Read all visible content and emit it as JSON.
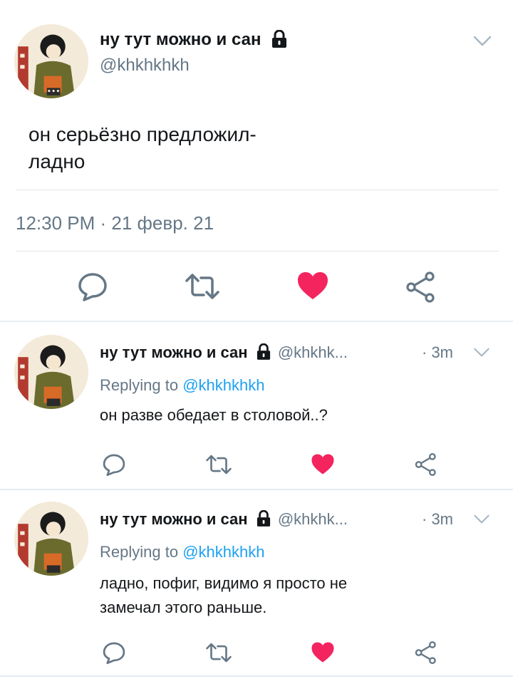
{
  "main_tweet": {
    "display_name": "ну тут можно и сан",
    "handle": "@khkhkhkh",
    "text_line1": "он серьёзно предложил-",
    "text_line2": "ладно",
    "timestamp": "12:30 PM · 21 февр. 21"
  },
  "replies": [
    {
      "display_name": "ну тут можно и сан",
      "handle": "@khkhk...",
      "time": "· 3m",
      "replying_prefix": "Replying to ",
      "replying_to": "@khkhkhkh",
      "text_line1": "он разве обедает в столовой..?",
      "text_line2": ""
    },
    {
      "display_name": "ну тут можно и сан",
      "handle": "@khkhk...",
      "time": "· 3m",
      "replying_prefix": "Replying to ",
      "replying_to": "@khkhkhkh",
      "text_line1": "ладно, пофиг, видимо я просто не",
      "text_line2": "замечал этого раньше."
    }
  ],
  "icons": {
    "reply": "speech-bubble-icon",
    "retweet": "retweet-icon",
    "like": "heart-icon",
    "share": "share-icon",
    "protected": "lock-icon",
    "more": "chevron-down-icon"
  },
  "colors": {
    "like_red": "#f4245e",
    "mention_blue": "#1da1f2",
    "secondary_gray": "#657786",
    "divider": "#e1e8ed"
  }
}
